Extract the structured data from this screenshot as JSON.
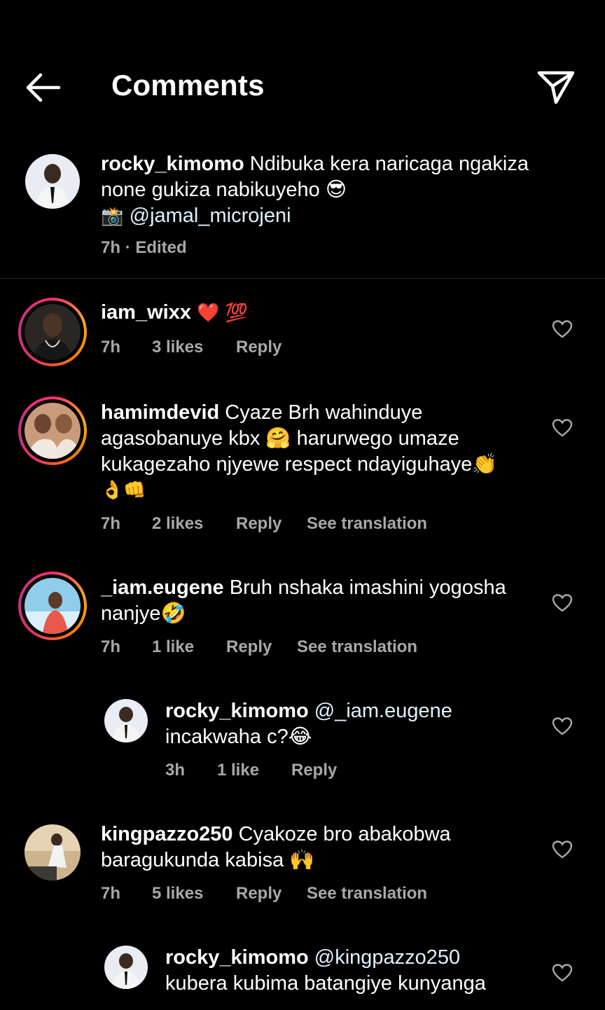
{
  "header": {
    "title": "Comments",
    "back_icon": "arrow-left-icon",
    "share_icon": "paper-plane-icon"
  },
  "caption": {
    "username": "rocky_kimomo",
    "line1": " Ndibuka kera naricaga ngakiza",
    "line2": "none gukiza nabikuyeho 😎",
    "line3_prefix": "📸 ",
    "mention": "@jamal_microjeni",
    "meta": "7h · Edited"
  },
  "comments": [
    {
      "username": "iam_wixx",
      "text": " ❤️ 💯",
      "time": "7h",
      "likes": "3 likes",
      "reply": "Reply"
    },
    {
      "username": "hamimdevid",
      "line1": " Cyaze Brh wahinduye",
      "line2": "agasobanuye kbx 🤗 harurwego umaze",
      "line3": "kukagezaho njyewe respect ndayiguhaye👏",
      "line4": "👌👊",
      "time": "7h",
      "likes": "2 likes",
      "reply": "Reply",
      "translate": "See translation"
    },
    {
      "username": "_iam.eugene",
      "line1": " Bruh nshaka imashini yogosha",
      "line2": "nanjye🤣",
      "time": "7h",
      "likes": "1 like",
      "reply": "Reply",
      "translate": "See translation"
    },
    {
      "username": "rocky_kimomo",
      "mention": " @_iam.eugene",
      "line2": "incakwaha c?😂",
      "time": "3h",
      "likes": "1 like",
      "reply": "Reply"
    },
    {
      "username": "kingpazzo250",
      "line1": " Cyakoze bro abakobwa",
      "line2": "baragukunda kabisa 🙌",
      "time": "7h",
      "likes": "5 likes",
      "reply": "Reply",
      "translate": "See translation"
    },
    {
      "username": "rocky_kimomo",
      "mention": " @kingpazzo250",
      "line2": "kubera kubima batangiye kunyanga"
    }
  ],
  "colors": {
    "background": "#000000",
    "text": "#ffffff",
    "meta": "#a8a8a8",
    "story_ring": "#e1306c"
  }
}
